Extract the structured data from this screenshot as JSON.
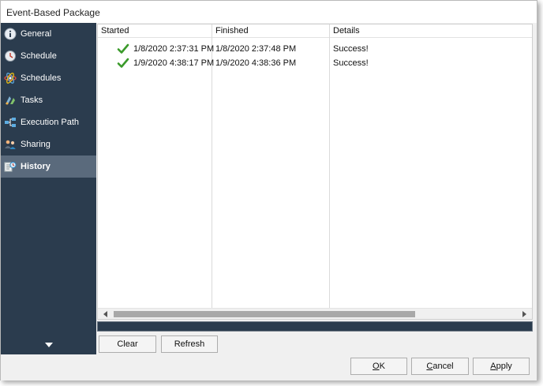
{
  "window": {
    "title": "Event-Based Package"
  },
  "sidebar": {
    "items": [
      {
        "label": "General",
        "icon": "info-icon",
        "active": false
      },
      {
        "label": "Schedule",
        "icon": "clock-icon",
        "active": false
      },
      {
        "label": "Schedules",
        "icon": "atom-icon",
        "active": false
      },
      {
        "label": "Tasks",
        "icon": "tasks-icon",
        "active": false
      },
      {
        "label": "Execution Path",
        "icon": "flow-icon",
        "active": false
      },
      {
        "label": "Sharing",
        "icon": "users-icon",
        "active": false
      },
      {
        "label": "History",
        "icon": "history-icon",
        "active": true
      }
    ]
  },
  "history": {
    "columns": [
      "Started",
      "Finished",
      "Details"
    ],
    "rows": [
      {
        "started": "1/8/2020 2:37:31 PM",
        "finished": "1/8/2020 2:37:48 PM",
        "details": "Success!"
      },
      {
        "started": "1/9/2020 4:38:17 PM",
        "finished": "1/9/2020 4:38:36 PM",
        "details": "Success!"
      }
    ]
  },
  "actions": {
    "clear": "Clear",
    "refresh": "Refresh"
  },
  "footer": {
    "ok_mnemonic": "O",
    "ok_rest": "K",
    "cancel_mnemonic": "C",
    "cancel_rest": "ancel",
    "apply_mnemonic": "A",
    "apply_rest": "pply"
  },
  "colors": {
    "sidebar": "#2b3c4e",
    "sidebar_active": "#5a6a7c",
    "check": "#3a9a2a"
  }
}
